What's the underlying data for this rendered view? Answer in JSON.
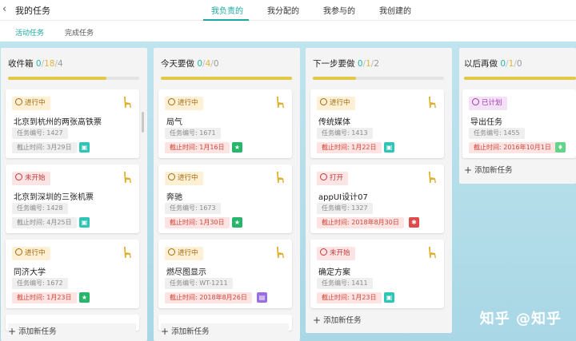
{
  "header": {
    "back_icon": "back-arrow-icon",
    "title": "我的任务",
    "tabs": [
      {
        "label": "我负责的",
        "active": true
      },
      {
        "label": "我分配的",
        "active": false
      },
      {
        "label": "我参与的",
        "active": false
      },
      {
        "label": "我创建的",
        "active": false
      }
    ],
    "accent": "#1aa9a0"
  },
  "subtabs": [
    {
      "label": "活动任务",
      "active": true
    },
    {
      "label": "完成任务",
      "active": false
    }
  ],
  "columns": [
    {
      "title": "收件箱",
      "count_a": "0",
      "count_b": "18",
      "count_c": "4",
      "progress": 0.75,
      "add_label": "添加新任务",
      "tasks": [
        {
          "status": "进行中",
          "title": "北京到杭州的两张高铁票",
          "id": "任务编号: 1427",
          "due": "截止时间: 3月29日",
          "due_color": "gray",
          "badge_color": "#2ec5b6"
        },
        {
          "status": "未开始",
          "title": "北京到深圳的三张机票",
          "id": "任务编号: 1428",
          "due": "截止时间: 4月25日",
          "due_color": "gray",
          "badge_color": "#2ec5b6"
        },
        {
          "status": "进行中",
          "title": "同济大学",
          "id": "任务编号: 1672",
          "due": "截止时间: 1月23日",
          "due_color": "red",
          "badge_color": "#27b56b"
        }
      ]
    },
    {
      "title": "今天要做",
      "count_a": "0",
      "count_b": "4",
      "count_c": "0",
      "progress": 1.0,
      "add_label": "添加新任务",
      "tasks": [
        {
          "status": "进行中",
          "title": "局气",
          "id": "任务编号: 1671",
          "due": "截止时间: 1月16日",
          "due_color": "red",
          "badge_color": "#27b56b"
        },
        {
          "status": "进行中",
          "title": "奔驰",
          "id": "任务编号: 1673",
          "due": "截止时间: 1月30日",
          "due_color": "red",
          "badge_color": "#27b56b"
        },
        {
          "status": "进行中",
          "title": "燃尽图显示",
          "id": "任务编号: WT-1211",
          "due": "截止时间: 2018年8月26日",
          "due_color": "red",
          "badge_color": "#9b6ee0"
        }
      ]
    },
    {
      "title": "下一步要做",
      "count_a": "0",
      "count_b": "1",
      "count_c": "2",
      "progress": 0.33,
      "add_label": "添加新任务",
      "tasks": [
        {
          "status": "进行中",
          "title": "传统媒体",
          "id": "任务编号: 1413",
          "due": "截止时间: 1月22日",
          "due_color": "red",
          "badge_color": "#2ec5b6"
        },
        {
          "status": "打开",
          "title": "appUI设计07",
          "id": "任务编号: 1327",
          "due": "截止时间: 2018年8月30日",
          "due_color": "red",
          "badge_color": "#e04a4a"
        },
        {
          "status": "未开始",
          "title": "确定方案",
          "id": "任务编号: 1411",
          "due": "截止时间: 1月23日",
          "due_color": "red",
          "badge_color": "#2ec5b6"
        }
      ]
    },
    {
      "title": "以后再做",
      "count_a": "0",
      "count_b": "1",
      "count_c": "0",
      "progress": 1.0,
      "add_label": "添加新任务",
      "tasks": [
        {
          "status": "已计划",
          "title": "导出任务",
          "id": "任务编号: 1455",
          "due": "截止时间: 2016年10月1日",
          "due_color": "red",
          "badge_color": "#63d48a"
        }
      ]
    }
  ],
  "watermark": "知乎 @知乎"
}
